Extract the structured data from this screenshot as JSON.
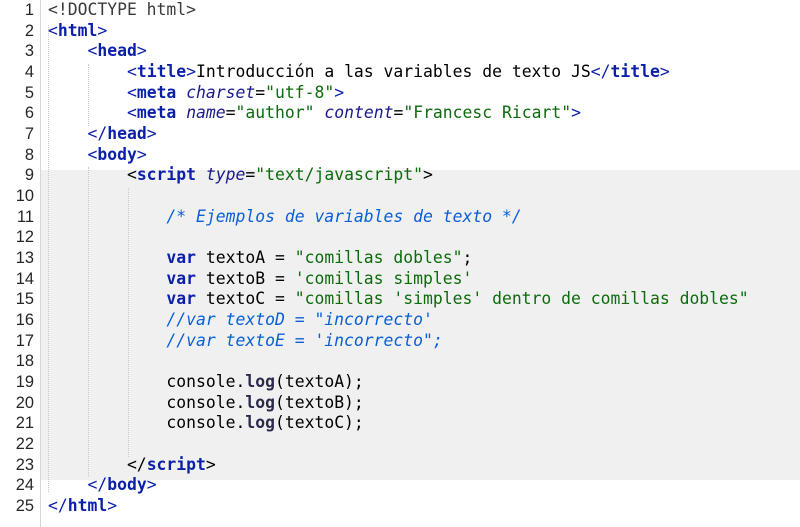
{
  "editor": {
    "line_numbers": [
      "1",
      "2",
      "3",
      "4",
      "5",
      "6",
      "7",
      "8",
      "9",
      "10",
      "11",
      "12",
      "13",
      "14",
      "15",
      "16",
      "17",
      "18",
      "19",
      "20",
      "21",
      "22",
      "23",
      "24",
      "25"
    ],
    "lines": [
      [
        {
          "t": "doctype",
          "v": "<!DOCTYPE html>"
        }
      ],
      [
        {
          "t": "punct",
          "v": "<"
        },
        {
          "t": "tag",
          "v": "html"
        },
        {
          "t": "punct",
          "v": ">"
        }
      ],
      [
        {
          "t": "plain",
          "v": "    "
        },
        {
          "t": "punct",
          "v": "<"
        },
        {
          "t": "tag",
          "v": "head"
        },
        {
          "t": "punct",
          "v": ">"
        }
      ],
      [
        {
          "t": "plain",
          "v": "        "
        },
        {
          "t": "punct",
          "v": "<"
        },
        {
          "t": "tag",
          "v": "title"
        },
        {
          "t": "punct",
          "v": ">"
        },
        {
          "t": "plain",
          "v": "Introducción a las variables de texto JS"
        },
        {
          "t": "punct",
          "v": "</"
        },
        {
          "t": "tag",
          "v": "title"
        },
        {
          "t": "punct",
          "v": ">"
        }
      ],
      [
        {
          "t": "plain",
          "v": "        "
        },
        {
          "t": "punct",
          "v": "<"
        },
        {
          "t": "tag",
          "v": "meta"
        },
        {
          "t": "plain",
          "v": " "
        },
        {
          "t": "attr",
          "v": "charset"
        },
        {
          "t": "plain",
          "v": "="
        },
        {
          "t": "str",
          "v": "\"utf-8\""
        },
        {
          "t": "punct",
          "v": ">"
        }
      ],
      [
        {
          "t": "plain",
          "v": "        "
        },
        {
          "t": "punct",
          "v": "<"
        },
        {
          "t": "tag",
          "v": "meta"
        },
        {
          "t": "plain",
          "v": " "
        },
        {
          "t": "attr",
          "v": "name"
        },
        {
          "t": "plain",
          "v": "="
        },
        {
          "t": "str",
          "v": "\"author\""
        },
        {
          "t": "plain",
          "v": " "
        },
        {
          "t": "attr",
          "v": "content"
        },
        {
          "t": "plain",
          "v": "="
        },
        {
          "t": "str",
          "v": "\"Francesc Ricart\""
        },
        {
          "t": "punct",
          "v": ">"
        }
      ],
      [
        {
          "t": "plain",
          "v": "    "
        },
        {
          "t": "punct",
          "v": "</"
        },
        {
          "t": "tag",
          "v": "head"
        },
        {
          "t": "punct",
          "v": ">"
        }
      ],
      [
        {
          "t": "plain",
          "v": "    "
        },
        {
          "t": "punct",
          "v": "<"
        },
        {
          "t": "tag",
          "v": "body"
        },
        {
          "t": "punct",
          "v": ">"
        }
      ],
      [
        {
          "t": "plain",
          "v": "        <"
        },
        {
          "t": "kw",
          "v": "script"
        },
        {
          "t": "plain",
          "v": " "
        },
        {
          "t": "attr",
          "v": "type"
        },
        {
          "t": "plain",
          "v": "="
        },
        {
          "t": "str",
          "v": "\"text/javascript\""
        },
        {
          "t": "plain",
          "v": ">"
        }
      ],
      [],
      [
        {
          "t": "plain",
          "v": "            "
        },
        {
          "t": "comment",
          "v": "/* Ejemplos de variables de texto */"
        }
      ],
      [],
      [
        {
          "t": "plain",
          "v": "            "
        },
        {
          "t": "kw",
          "v": "var"
        },
        {
          "t": "plain",
          "v": " textoA = "
        },
        {
          "t": "str",
          "v": "\"comillas dobles\""
        },
        {
          "t": "plain",
          "v": ";"
        }
      ],
      [
        {
          "t": "plain",
          "v": "            "
        },
        {
          "t": "kw",
          "v": "var"
        },
        {
          "t": "plain",
          "v": " textoB = "
        },
        {
          "t": "str",
          "v": "'comillas simples'"
        }
      ],
      [
        {
          "t": "plain",
          "v": "            "
        },
        {
          "t": "kw",
          "v": "var"
        },
        {
          "t": "plain",
          "v": " textoC = "
        },
        {
          "t": "str",
          "v": "\"comillas 'simples' dentro de comillas dobles\""
        }
      ],
      [
        {
          "t": "plain",
          "v": "            "
        },
        {
          "t": "comment",
          "v": "//var textoD = \"incorrecto'"
        }
      ],
      [
        {
          "t": "plain",
          "v": "            "
        },
        {
          "t": "comment",
          "v": "//var textoE = 'incorrecto\";"
        }
      ],
      [],
      [
        {
          "t": "plain",
          "v": "            console."
        },
        {
          "t": "method",
          "v": "log"
        },
        {
          "t": "plain",
          "v": "(textoA);"
        }
      ],
      [
        {
          "t": "plain",
          "v": "            console."
        },
        {
          "t": "method",
          "v": "log"
        },
        {
          "t": "plain",
          "v": "(textoB);"
        }
      ],
      [
        {
          "t": "plain",
          "v": "            console."
        },
        {
          "t": "method",
          "v": "log"
        },
        {
          "t": "plain",
          "v": "(textoC);"
        }
      ],
      [],
      [
        {
          "t": "plain",
          "v": "        </"
        },
        {
          "t": "kw",
          "v": "script"
        },
        {
          "t": "plain",
          "v": ">"
        }
      ],
      [
        {
          "t": "plain",
          "v": "    "
        },
        {
          "t": "punct",
          "v": "</"
        },
        {
          "t": "tag",
          "v": "body"
        },
        {
          "t": "punct",
          "v": ">"
        }
      ],
      [
        {
          "t": "punct",
          "v": "</"
        },
        {
          "t": "tag",
          "v": "html"
        },
        {
          "t": "punct",
          "v": ">"
        }
      ]
    ]
  }
}
